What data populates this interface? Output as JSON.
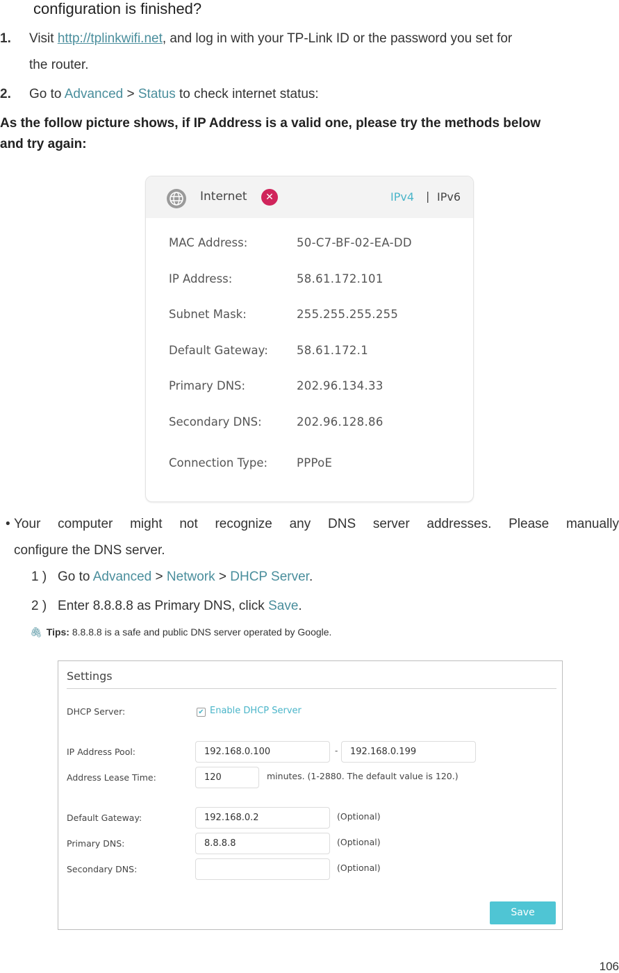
{
  "heading": "configuration is finished?",
  "steps": [
    {
      "num": "1.",
      "prefix": "Visit ",
      "link": "http://tplinkwifi.net",
      "suffix": ", and log in with your TP-Link ID or the password you set for",
      "line2": "the router."
    },
    {
      "num": "2.",
      "prefix": "Go to ",
      "link1": "Advanced",
      "sep": " > ",
      "link2": "Status",
      "suffix": " to check internet status:"
    }
  ],
  "intro": {
    "line1": "As the follow picture shows, if IP Address is a valid one, please try the methods below",
    "line2": "and try again:"
  },
  "status_card": {
    "title": "Internet",
    "status": "disconnected",
    "ipv4_tab": "IPv4",
    "separator": "|",
    "ipv6_tab": "IPv6",
    "rows": [
      {
        "label": "MAC Address:",
        "value": "50-C7-BF-02-EA-DD"
      },
      {
        "label": "IP Address:",
        "value": "58.61.172.101"
      },
      {
        "label": "Subnet Mask:",
        "value": "255.255.255.255"
      },
      {
        "label": "Default Gateway:",
        "value": "58.61.172.1"
      },
      {
        "label": "Primary DNS:",
        "value": "202.96.134.33"
      },
      {
        "label": "Secondary DNS:",
        "value": "202.96.128.86"
      },
      {
        "label": "Connection Type:",
        "value": "PPPoE"
      }
    ]
  },
  "bullet": {
    "line1": "Your computer might not recognize any DNS server addresses. Please manually",
    "line2": "configure the DNS server."
  },
  "sub_steps": [
    {
      "num": "1 )",
      "prefix": "Go to ",
      "link1": "Advanced",
      "link2": "Network",
      "link3": "DHCP Server",
      "sep": " > ",
      "suffix": "."
    },
    {
      "num": "2 )",
      "prefix": "Enter 8.8.8.8 as Primary DNS, click ",
      "link": "Save",
      "suffix": "."
    }
  ],
  "tips": {
    "label": "Tips:",
    "text": " 8.8.8.8 is a safe and public DNS server operated by Google."
  },
  "settings": {
    "title": "Settings",
    "dhcp_server_label": "DHCP Server:",
    "enable_label": "Enable DHCP Server",
    "enable_checked": true,
    "ip_pool_label": "IP Address Pool:",
    "ip_pool_start": "192.168.0.100",
    "ip_pool_dash": "-",
    "ip_pool_end": "192.168.0.199",
    "lease_label": "Address Lease Time:",
    "lease_value": "120",
    "lease_hint": "minutes. (1-2880. The default value is 120.)",
    "gateway_label": "Default Gateway:",
    "gateway_value": "192.168.0.2",
    "primary_dns_label": "Primary DNS:",
    "primary_dns_value": "8.8.8.8",
    "secondary_dns_label": "Secondary DNS:",
    "secondary_dns_value": "",
    "optional": "(Optional)",
    "save_label": "Save"
  },
  "colors": {
    "link": "#4a8e9c",
    "accent": "#4ab5c9",
    "error": "#d0245b",
    "save_button": "#4fc5d4"
  },
  "page_number": "106"
}
